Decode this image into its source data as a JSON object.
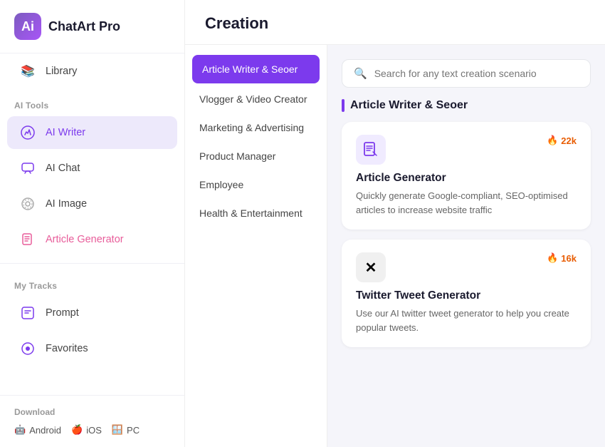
{
  "logo": {
    "icon_text": "Ai",
    "app_name": "ChatArt Pro"
  },
  "sidebar": {
    "library_label": "Library",
    "ai_tools_section": "AI Tools",
    "items": [
      {
        "id": "library",
        "label": "Library",
        "icon": "📚",
        "active": false
      },
      {
        "id": "ai-writer",
        "label": "AI Writer",
        "icon": "✏️",
        "active": true
      },
      {
        "id": "ai-chat",
        "label": "AI Chat",
        "icon": "💬",
        "active": false
      },
      {
        "id": "ai-image",
        "label": "AI Image",
        "icon": "🎨",
        "active": false
      },
      {
        "id": "article-gen",
        "label": "Article Generator",
        "icon": "📝",
        "active": false
      }
    ],
    "my_tracks_section": "My Tracks",
    "tracks": [
      {
        "id": "prompt",
        "label": "Prompt",
        "icon": "⚡"
      },
      {
        "id": "favorites",
        "label": "Favorites",
        "icon": "💜"
      }
    ],
    "download_section": "Download",
    "download_links": [
      {
        "id": "android",
        "label": "Android",
        "icon": "🤖"
      },
      {
        "id": "ios",
        "label": "iOS",
        "icon": "🍎"
      },
      {
        "id": "pc",
        "label": "PC",
        "icon": "🪟"
      }
    ]
  },
  "main": {
    "header_title": "Creation",
    "search_placeholder": "Search for any text creation scenario",
    "section_title": "Article Writer & Seoer",
    "categories": [
      {
        "id": "article-writer",
        "label": "Article Writer & Seoer",
        "active": true
      },
      {
        "id": "vlogger",
        "label": "Vlogger & Video Creator",
        "active": false
      },
      {
        "id": "marketing",
        "label": "Marketing & Advertising",
        "active": false
      },
      {
        "id": "product-manager",
        "label": "Product Manager",
        "active": false
      },
      {
        "id": "employee",
        "label": "Employee",
        "active": false
      },
      {
        "id": "health",
        "label": "Health & Entertainment",
        "active": false
      }
    ],
    "cards": [
      {
        "id": "article-generator",
        "title": "Article Generator",
        "description": "Quickly generate Google-compliant, SEO-optimised articles to increase website traffic",
        "icon_type": "document",
        "badge_count": "22k"
      },
      {
        "id": "twitter-tweet",
        "title": "Twitter Tweet Generator",
        "description": "Use our AI twitter tweet generator to help you create popular tweets.",
        "icon_type": "twitter",
        "badge_count": "16k"
      }
    ]
  }
}
